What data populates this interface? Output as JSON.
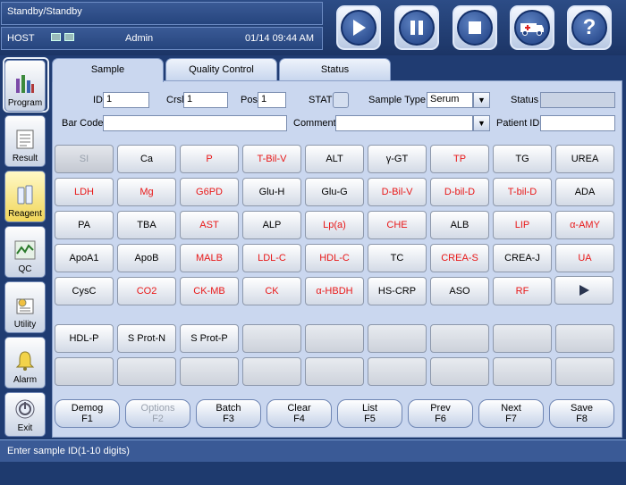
{
  "header": {
    "state": "Standby/Standby",
    "host": "HOST",
    "user": "Admin",
    "datetime": "01/14 09:44 AM",
    "buttons": [
      {
        "name": "run-button",
        "icon": "play-icon"
      },
      {
        "name": "pause-button",
        "icon": "pause-icon"
      },
      {
        "name": "stop-button",
        "icon": "stop-icon"
      },
      {
        "name": "emergency-button",
        "icon": "ambulance-icon"
      },
      {
        "name": "help-button",
        "icon": "help-icon",
        "glyph": "?"
      }
    ]
  },
  "nav": {
    "items": [
      {
        "label": "Program",
        "icon": "program-icon",
        "active": false
      },
      {
        "label": "Result",
        "icon": "result-icon",
        "active": false
      },
      {
        "label": "Reagent",
        "icon": "reagent-icon",
        "active": true
      },
      {
        "label": "QC",
        "icon": "qc-icon",
        "active": false
      },
      {
        "label": "Utility",
        "icon": "utility-icon",
        "active": false
      },
      {
        "label": "Alarm",
        "icon": "alarm-icon",
        "active": false
      },
      {
        "label": "Exit",
        "icon": "exit-icon",
        "active": false
      }
    ]
  },
  "tabs": [
    {
      "label": "Sample",
      "active": true
    },
    {
      "label": "Quality Control",
      "active": false
    },
    {
      "label": "Status",
      "active": false
    }
  ],
  "form": {
    "id_label": "ID",
    "id_value": "1",
    "crsl_label": "Crsl",
    "crsl_value": "1",
    "pos_label": "Pos",
    "pos_value": "1",
    "stat_label": "STAT",
    "sample_type_label": "Sample Type",
    "sample_type_value": "Serum",
    "status_label": "Status",
    "status_value": "",
    "barcode_label": "Bar Code",
    "barcode_value": "",
    "comment_label": "Comment",
    "comment_value": "",
    "patient_label": "Patient ID",
    "patient_value": ""
  },
  "tests": [
    [
      {
        "t": "SI",
        "c": "dis"
      },
      {
        "t": "Ca",
        "c": ""
      },
      {
        "t": "P",
        "c": "red"
      },
      {
        "t": "T-Bil-V",
        "c": "red"
      },
      {
        "t": "ALT",
        "c": ""
      },
      {
        "t": "γ-GT",
        "c": ""
      },
      {
        "t": "TP",
        "c": "red"
      },
      {
        "t": "TG",
        "c": ""
      },
      {
        "t": "UREA",
        "c": ""
      }
    ],
    [
      {
        "t": "LDH",
        "c": "red"
      },
      {
        "t": "Mg",
        "c": "red"
      },
      {
        "t": "G6PD",
        "c": "red"
      },
      {
        "t": "Glu-H",
        "c": ""
      },
      {
        "t": "Glu-G",
        "c": ""
      },
      {
        "t": "D-Bil-V",
        "c": "red"
      },
      {
        "t": "D-bil-D",
        "c": "red"
      },
      {
        "t": "T-bil-D",
        "c": "red"
      },
      {
        "t": "ADA",
        "c": ""
      }
    ],
    [
      {
        "t": "PA",
        "c": ""
      },
      {
        "t": "TBA",
        "c": ""
      },
      {
        "t": "AST",
        "c": "red"
      },
      {
        "t": "ALP",
        "c": ""
      },
      {
        "t": "Lp(a)",
        "c": "red"
      },
      {
        "t": "CHE",
        "c": "red"
      },
      {
        "t": "ALB",
        "c": ""
      },
      {
        "t": "LIP",
        "c": "red"
      },
      {
        "t": "α-AMY",
        "c": "red"
      }
    ],
    [
      {
        "t": "ApoA1",
        "c": ""
      },
      {
        "t": "ApoB",
        "c": ""
      },
      {
        "t": "MALB",
        "c": "red"
      },
      {
        "t": "LDL-C",
        "c": "red"
      },
      {
        "t": "HDL-C",
        "c": "red"
      },
      {
        "t": "TC",
        "c": ""
      },
      {
        "t": "CREA-S",
        "c": "red"
      },
      {
        "t": "CREA-J",
        "c": ""
      },
      {
        "t": "UA",
        "c": "red"
      }
    ],
    [
      {
        "t": "CysC",
        "c": ""
      },
      {
        "t": "CO2",
        "c": "red"
      },
      {
        "t": "CK-MB",
        "c": "red"
      },
      {
        "t": "CK",
        "c": "red"
      },
      {
        "t": "α-HBDH",
        "c": "red"
      },
      {
        "t": "HS-CRP",
        "c": ""
      },
      {
        "t": "ASO",
        "c": ""
      },
      {
        "t": "RF",
        "c": "red"
      }
    ]
  ],
  "profiles": [
    [
      {
        "t": "HDL-P"
      },
      {
        "t": "S Prot-N"
      },
      {
        "t": "S Prot-P"
      },
      {
        "t": ""
      },
      {
        "t": ""
      },
      {
        "t": ""
      },
      {
        "t": ""
      },
      {
        "t": ""
      },
      {
        "t": ""
      }
    ],
    [
      {
        "t": ""
      },
      {
        "t": ""
      },
      {
        "t": ""
      },
      {
        "t": ""
      },
      {
        "t": ""
      },
      {
        "t": ""
      },
      {
        "t": ""
      },
      {
        "t": ""
      },
      {
        "t": ""
      }
    ]
  ],
  "fkeys": [
    {
      "label": "Demog",
      "key": "F1",
      "disabled": false
    },
    {
      "label": "Options",
      "key": "F2",
      "disabled": true
    },
    {
      "label": "Batch",
      "key": "F3",
      "disabled": false
    },
    {
      "label": "Clear",
      "key": "F4",
      "disabled": false
    },
    {
      "label": "List",
      "key": "F5",
      "disabled": false
    },
    {
      "label": "Prev",
      "key": "F6",
      "disabled": false
    },
    {
      "label": "Next",
      "key": "F7",
      "disabled": false
    },
    {
      "label": "Save",
      "key": "F8",
      "disabled": false
    }
  ],
  "message": "Enter sample ID(1-10 digits)"
}
